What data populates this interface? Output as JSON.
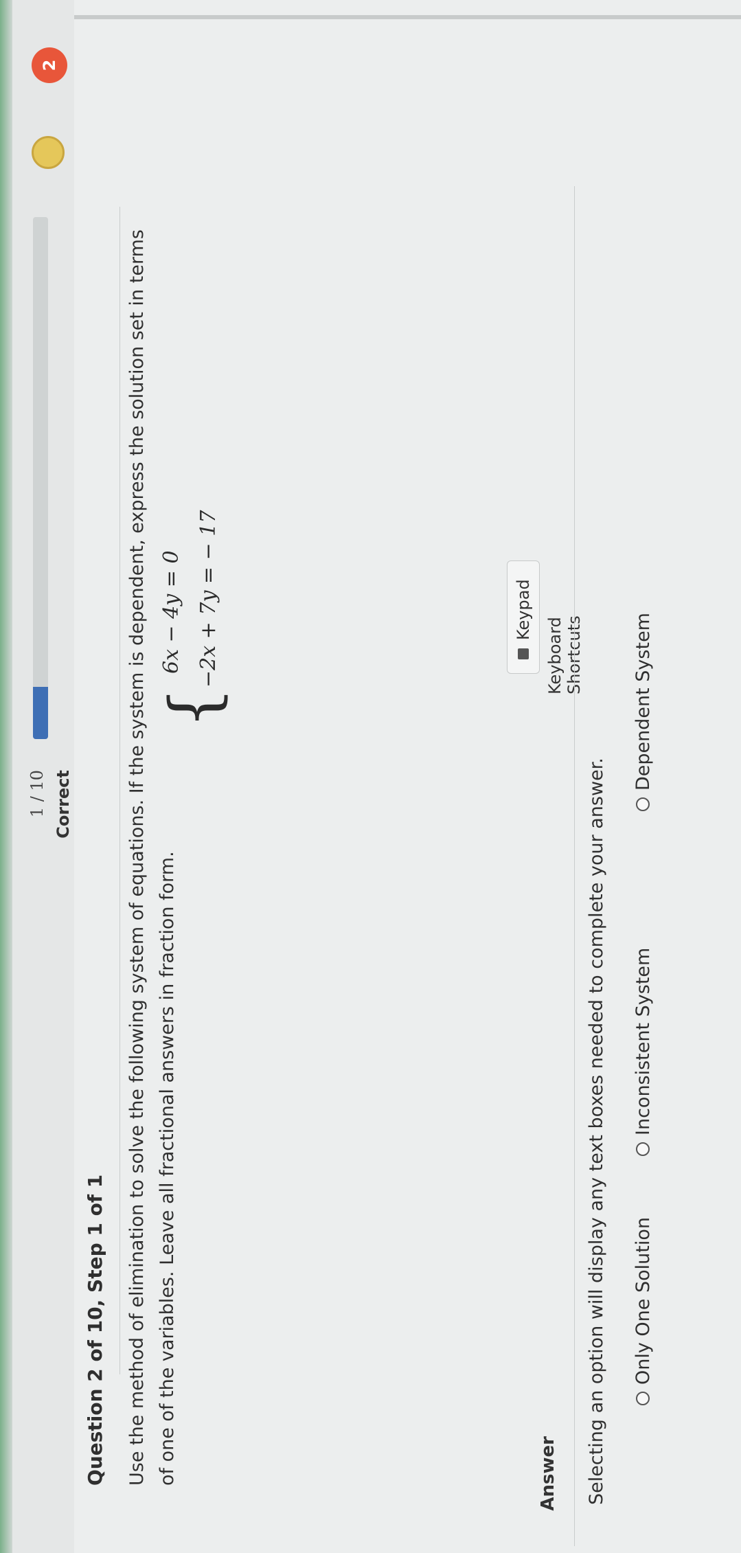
{
  "header": {
    "progress_text": "1 / 10",
    "progress_fraction": 0.1,
    "status": "Correct",
    "score_badge": "2",
    "accent_color": "#3e6fb5",
    "badge_color": "#e8563a",
    "medal_icon": "medal-icon"
  },
  "question": {
    "title": "Question 2 of 10, Step 1 of 1",
    "instructions": "Use the method of elimination to solve the following system of equations. If the system is dependent, express the solution set in terms of one of the variables. Leave all fractional answers in fraction form.",
    "equations": [
      "6x − 4y =   0",
      "−2x + 7y = − 17"
    ]
  },
  "tools": {
    "keypad_label": "Keypad",
    "shortcuts_label": "Keyboard Shortcuts",
    "keypad_icon": "keyboard-icon"
  },
  "answer": {
    "label": "Answer",
    "hint": "Selecting an option will display any text boxes needed to complete your answer.",
    "options": [
      "Only One Solution",
      "Inconsistent System",
      "Dependent System"
    ],
    "selected_option": ""
  }
}
